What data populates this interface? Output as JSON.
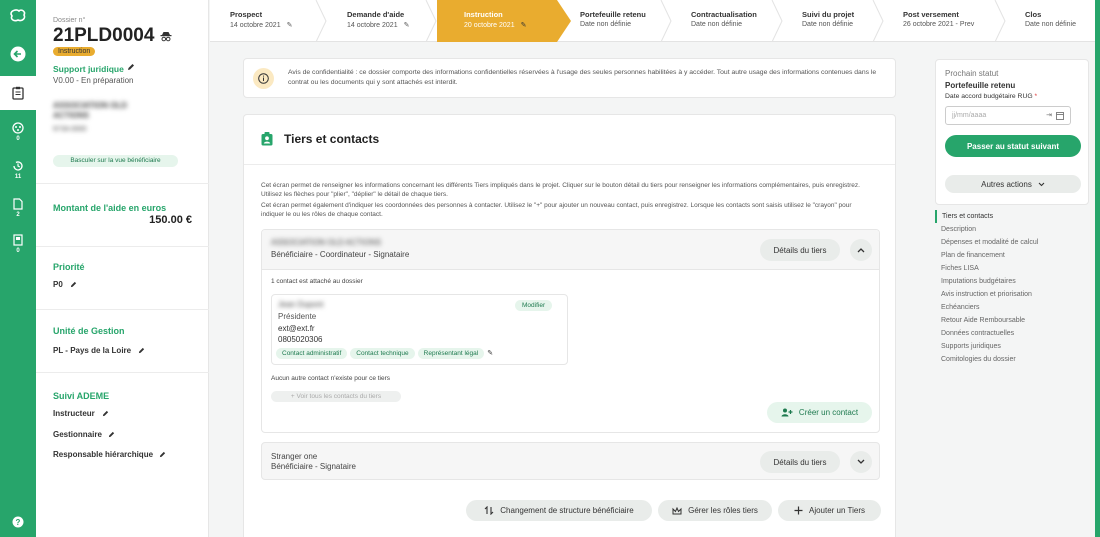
{
  "dossier": {
    "label": "Dossier n°",
    "number": "21PLD0004",
    "status_badge": "Instruction",
    "type": "Support juridique",
    "version": "V0.00 - En préparation",
    "org_line1": "ASSOCIATION OLD",
    "org_line2": "ACTIONS",
    "org_line3": "N°0A 0000",
    "switch_button": "Basculer sur la vue bénéficiaire"
  },
  "rail": {
    "badges": [
      "0",
      "11",
      "2",
      "0"
    ]
  },
  "amount": {
    "label": "Montant de l'aide en euros",
    "value": "150.00 €"
  },
  "priority": {
    "label": "Priorité",
    "value": "P0"
  },
  "unit": {
    "label": "Unité de Gestion",
    "value": "PL - Pays de la Loire"
  },
  "suivi": {
    "label": "Suivi ADEME",
    "items": [
      "Instructeur",
      "Gestionnaire",
      "Responsable hiérarchique"
    ]
  },
  "steps": [
    {
      "title": "Prospect",
      "date": "14 octobre 2021"
    },
    {
      "title": "Demande d'aide",
      "date": "14 octobre 2021"
    },
    {
      "title": "Instruction",
      "date": "20 octobre 2021"
    },
    {
      "title": "Portefeuille retenu",
      "date": "Date non définie"
    },
    {
      "title": "Contractualisation",
      "date": "Date non définie"
    },
    {
      "title": "Suivi du projet",
      "date": "Date non définie"
    },
    {
      "title": "Post versement",
      "date": "26 octobre 2021 - Prev"
    },
    {
      "title": "Clos",
      "date": "Date non définie"
    }
  ],
  "notice": "Avis de confidentialité : ce dossier comporte des informations confidentielles réservées à l'usage des seules personnes habilitées à y accéder. Tout autre usage des informations contenues dans le contrat ou les documents qui y sont attachés est interdit.",
  "tiers": {
    "title": "Tiers et contacts",
    "intro1": "Cet écran permet de renseigner les informations concernant les différents Tiers impliqués dans le projet. Cliquer sur le bouton détail du tiers pour renseigner les informations complémentaires, puis enregistrez. Utilisez les flèches pour \"plier\", \"déplier\" le détail de chaque tiers.",
    "intro2": "Cet écran permet également d'indiquer les coordonnées des personnes à contacter. Utilisez le \"+\" pour ajouter un nouveau contact, puis enregistrez. Lorsque les contacts sont saisis utilisez le \"crayon\" pour indiquer le ou les rôles de chaque contact.",
    "t1_name": "ASSOCIATION OLD ACTIONS",
    "t1_roles": "Bénéficiaire - Coordinateur - Signataire",
    "details_btn": "Détails du tiers",
    "contact_count": "1 contact est attaché au dossier",
    "contact_name": "Jean Dupont",
    "contact_role": "Présidente",
    "contact_email": "ext@ext.fr",
    "contact_phone": "0805020306",
    "modify_btn": "Modifier",
    "tags": [
      "Contact administratif",
      "Contact technique",
      "Représentant légal"
    ],
    "no_other": "Aucun autre contact n'existe pour ce tiers",
    "see_all": "Voir tous les contacts du tiers",
    "create_contact": "Créer un contact",
    "t2_name": "Stranger one",
    "t2_roles": "Bénéficiaire - Signataire",
    "btn_change": "Changement de structure bénéficiaire",
    "btn_roles": "Gérer les rôles tiers",
    "btn_add": "Ajouter un Tiers"
  },
  "next_status": {
    "label": "Prochain statut",
    "value": "Portefeuille retenu",
    "date_label": "Date accord budgétaire RUG",
    "required": "*",
    "date_placeholder": "jj/mm/aaaa",
    "next_btn": "Passer au statut suivant",
    "other_actions": "Autres actions"
  },
  "toc": [
    "Tiers et contacts",
    "Description",
    "Dépenses et modalité de calcul",
    "Plan de financement",
    "Fiches LISA",
    "Imputations budgétaires",
    "Avis instruction et priorisation",
    "Echéanciers",
    "Retour Aide Remboursable",
    "Données contractuelles",
    "Supports juridiques",
    "Comitologies du dossier"
  ],
  "colors": {
    "brand": "#27a56b",
    "active_step": "#e9ac2f"
  }
}
